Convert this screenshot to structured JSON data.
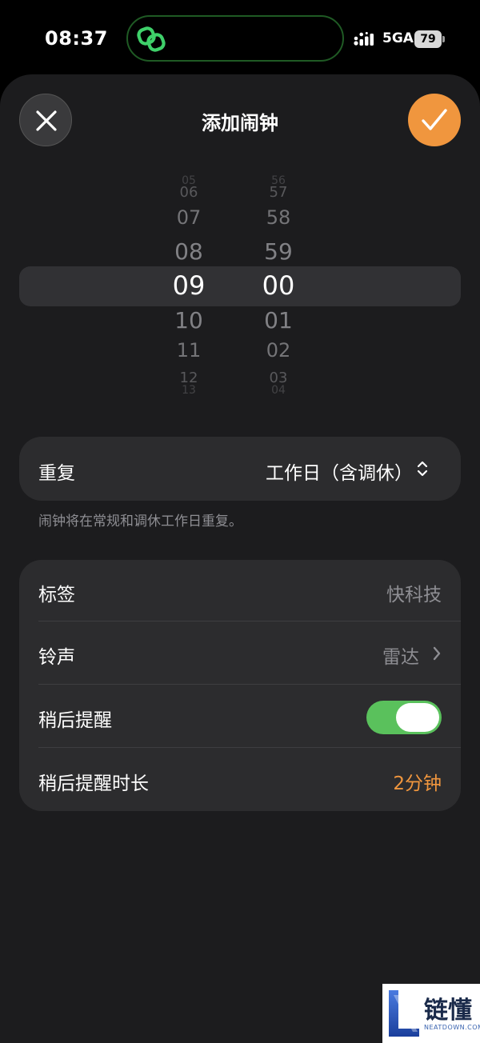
{
  "status_bar": {
    "time": "08:37",
    "network": "5GA",
    "battery": "79",
    "island_icon": "link-icon"
  },
  "header": {
    "title": "添加闹钟",
    "close_icon": "close-icon",
    "confirm_icon": "checkmark-icon"
  },
  "picker": {
    "hours": [
      "05",
      "06",
      "07",
      "08",
      "09",
      "10",
      "11",
      "12",
      "13"
    ],
    "minutes": [
      "56",
      "57",
      "58",
      "59",
      "00",
      "01",
      "02",
      "03",
      "04"
    ],
    "selected_hour": "09",
    "selected_minute": "00"
  },
  "repeat": {
    "label": "重复",
    "value": "工作日（含调休）",
    "hint": "闹钟将在常规和调休工作日重复。"
  },
  "settings": {
    "label_row": {
      "label": "标签",
      "value": "快科技"
    },
    "sound_row": {
      "label": "铃声",
      "value": "雷达"
    },
    "snooze_row": {
      "label": "稍后提醒",
      "enabled": true
    },
    "snooze_duration_row": {
      "label": "稍后提醒时长",
      "value": "2分钟"
    }
  },
  "watermark": {
    "text": "链懂",
    "sub": "NEATDOWN.COM"
  },
  "colors": {
    "accent": "#f0963e",
    "toggle_on": "#5ac15c",
    "island_border": "#1f5a24"
  }
}
